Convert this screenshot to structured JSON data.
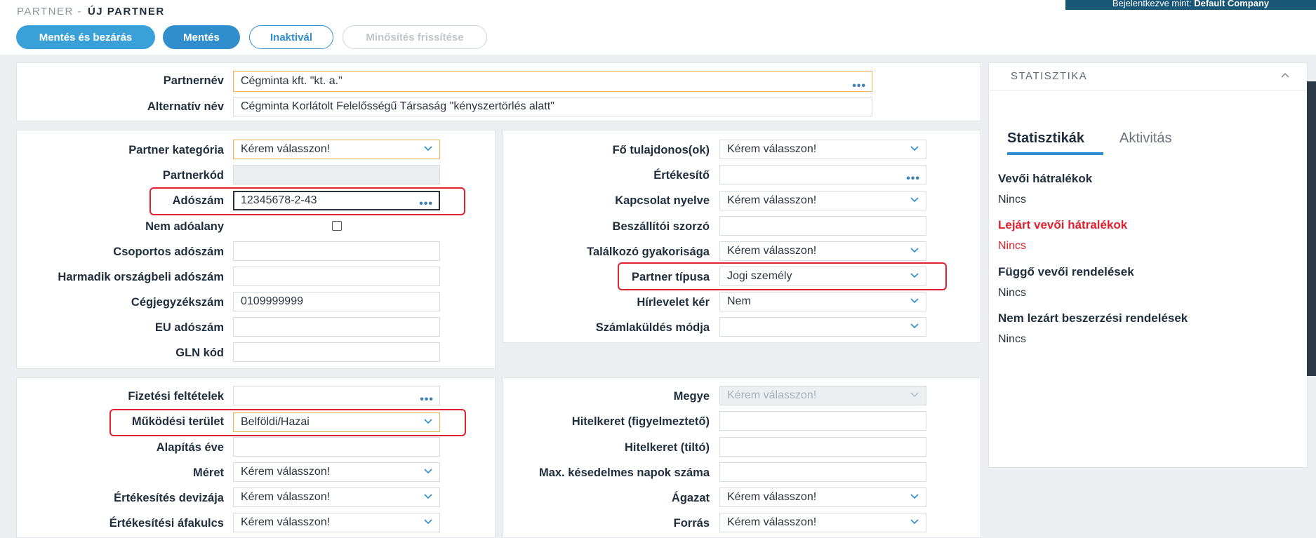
{
  "header": {
    "breadcrumb_parent": "PARTNER -",
    "breadcrumb_current": "ÚJ PARTNER",
    "user_prefix": "Bejelentkezve mint:",
    "user_name": "Default Company"
  },
  "toolbar": {
    "save_close": "Mentés és bezárás",
    "save": "Mentés",
    "inactivate": "Inaktivál",
    "refresh_rating": "Minősítés frissítése"
  },
  "form": {
    "partner_name": {
      "label": "Partnernév",
      "value": "Cégminta kft. \"kt. a.\""
    },
    "alt_name": {
      "label": "Alternatív név",
      "value": "Cégminta Korlátolt Felelősségű Társaság \"kényszertörlés alatt\""
    },
    "left1": [
      {
        "label": "Partner kategória",
        "value": "Kérem válasszon!"
      },
      {
        "label": "Partnerkód",
        "value": ""
      },
      {
        "label": "Adószám",
        "value": "12345678-2-43"
      },
      {
        "label": "Nem adóalany",
        "value": ""
      },
      {
        "label": "Csoportos adószám",
        "value": ""
      },
      {
        "label": "Harmadik országbeli adószám",
        "value": ""
      },
      {
        "label": "Cégjegyzékszám",
        "value": "0109999999"
      },
      {
        "label": "EU adószám",
        "value": ""
      },
      {
        "label": "GLN kód",
        "value": ""
      }
    ],
    "right1": [
      {
        "label": "Fő tulajdonos(ok)",
        "value": "Kérem válasszon!"
      },
      {
        "label": "Értékesítő",
        "value": ""
      },
      {
        "label": "Kapcsolat nyelve",
        "value": "Kérem válasszon!"
      },
      {
        "label": "Beszállítói szorzó",
        "value": ""
      },
      {
        "label": "Találkozó gyakorisága",
        "value": "Kérem válasszon!"
      },
      {
        "label": "Partner típusa",
        "value": "Jogi személy"
      },
      {
        "label": "Hírlevelet kér",
        "value": "Nem"
      },
      {
        "label": "Számlaküldés módja",
        "value": ""
      }
    ],
    "left2": [
      {
        "label": "Fizetési feltételek",
        "value": ""
      },
      {
        "label": "Működési terület",
        "value": "Belföldi/Hazai"
      },
      {
        "label": "Alapítás éve",
        "value": ""
      },
      {
        "label": "Méret",
        "value": "Kérem válasszon!"
      },
      {
        "label": "Értékesítés devizája",
        "value": "Kérem válasszon!"
      },
      {
        "label": "Értékesítési áfakulcs",
        "value": "Kérem válasszon!"
      }
    ],
    "right2": [
      {
        "label": "Megye",
        "value": "Kérem válasszon!"
      },
      {
        "label": "Hitelkeret (figyelmeztető)",
        "value": ""
      },
      {
        "label": "Hitelkeret (tiltó)",
        "value": ""
      },
      {
        "label": "Max. késedelmes napok száma",
        "value": ""
      },
      {
        "label": "Ágazat",
        "value": "Kérem válasszon!"
      },
      {
        "label": "Forrás",
        "value": "Kérem válasszon!"
      }
    ]
  },
  "stats": {
    "title": "STATISZTIKA",
    "tab_stats": "Statisztikák",
    "tab_activity": "Aktivitás",
    "items": [
      {
        "label": "Vevői hátralékok",
        "value": "Nincs"
      },
      {
        "label": "Lejárt vevői hátralékok",
        "value": "Nincs"
      },
      {
        "label": "Függő vevői rendelések",
        "value": "Nincs"
      },
      {
        "label": "Nem lezárt beszerzési rendelések",
        "value": "Nincs"
      }
    ]
  },
  "colors": {
    "primary": "#2f8ecb",
    "highlight": "#e0212f",
    "required_border": "#f0b24a"
  }
}
